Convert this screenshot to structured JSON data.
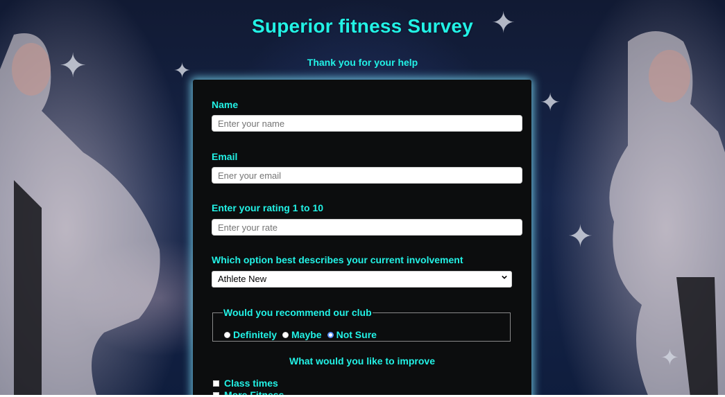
{
  "page": {
    "title": "Superior fitness Survey",
    "subtitle": "Thank you for your help",
    "accent_color": "#22f2e6",
    "panel_color": "#0c0d0e"
  },
  "form": {
    "name": {
      "label": "Name",
      "placeholder": "Enter your name",
      "value": ""
    },
    "email": {
      "label": "Email",
      "placeholder": "Ener your email",
      "value": ""
    },
    "rating": {
      "label": "Enter your rating 1 to 10",
      "placeholder": "Enter your rate",
      "value": ""
    },
    "involvement": {
      "label": "Which option best describes your current involvement",
      "selected": "Athlete New",
      "icon": "chevron-down-icon"
    },
    "recommend": {
      "legend": "Would you recommend our club",
      "options": [
        {
          "label": "Definitely",
          "selected": false
        },
        {
          "label": "Maybe",
          "selected": false
        },
        {
          "label": "Not Sure",
          "selected": true
        }
      ]
    },
    "improve": {
      "heading": "What would you like to improve",
      "options": [
        {
          "label": "Class times",
          "checked": false
        },
        {
          "label": "More Fitness",
          "checked": false
        }
      ]
    }
  }
}
